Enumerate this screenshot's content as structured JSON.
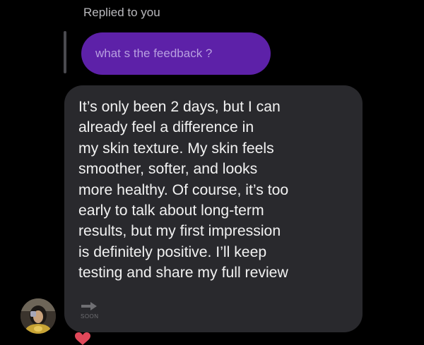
{
  "reply": {
    "caption": "Replied to you",
    "quoted_text": "what s the feedback ?"
  },
  "message": {
    "lines": [
      "It’s only been 2 days, but I can",
      "already feel a difference in",
      "my skin texture. My skin feels",
      "smoother, softer, and looks",
      "more healthy. Of course, it’s too",
      "early to talk about long-term",
      "results, but my first impression",
      "is definitely positive. I’ll keep",
      "testing and share my full review"
    ],
    "trailing_label": "SOON"
  },
  "icons": {
    "forward": "forward-arrow-icon",
    "avatar": "user-avatar",
    "reaction": "heart-icon"
  },
  "colors": {
    "background": "#000000",
    "quoted_bubble": "#5d21a8",
    "quoted_text": "#b89fe0",
    "message_bubble": "#29292d",
    "message_text": "#f2f2f2",
    "caption_text": "#b9b9bd",
    "reaction": "#e0485a"
  }
}
